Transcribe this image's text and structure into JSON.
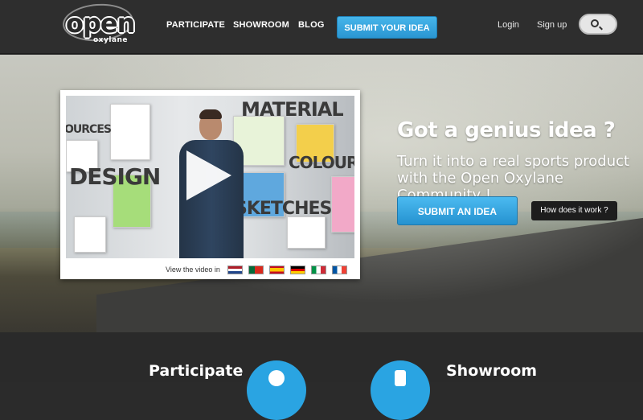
{
  "brand": {
    "logo_word": "open",
    "logo_sub": "oxylane"
  },
  "nav": {
    "participate": "PARTICIPATE",
    "showroom": "SHOWROOM",
    "blog": "BLOG",
    "submit_top": "SUBMIT YOUR IDEA",
    "login": "Login",
    "signup": "Sign up"
  },
  "hero": {
    "headline": "Got a genius idea ?",
    "tagline": "Turn it into a real sports product with the Open Oxylane Community !",
    "submit_label": "SUBMIT AN IDEA",
    "how_label": "How does it work ?"
  },
  "video": {
    "words": {
      "material": "MATERIAL",
      "sources": "OURCES",
      "design": "DESIGN",
      "colour": "COLOUR",
      "sketches": "SKETCHES"
    },
    "footer_label": "View the video in",
    "flags": [
      {
        "name": "netherlands",
        "colors": [
          "#ae1c28",
          "#ffffff",
          "#21468b"
        ]
      },
      {
        "name": "portugal",
        "colors": [
          "#046a38",
          "#da291c",
          "#da291c"
        ]
      },
      {
        "name": "spain",
        "colors": [
          "#c60b1e",
          "#ffc400",
          "#c60b1e"
        ]
      },
      {
        "name": "germany",
        "colors": [
          "#000000",
          "#dd0000",
          "#ffce00"
        ]
      },
      {
        "name": "italy",
        "colors": [
          "#009246",
          "#ffffff",
          "#ce2b37"
        ]
      },
      {
        "name": "france",
        "colors": [
          "#0055a4",
          "#ffffff",
          "#ef4135"
        ]
      }
    ]
  },
  "bottom": {
    "participate": "Participate",
    "showroom": "Showroom"
  },
  "colors": {
    "accent": "#2aa4e2",
    "topbar": "#2e2e2e"
  }
}
